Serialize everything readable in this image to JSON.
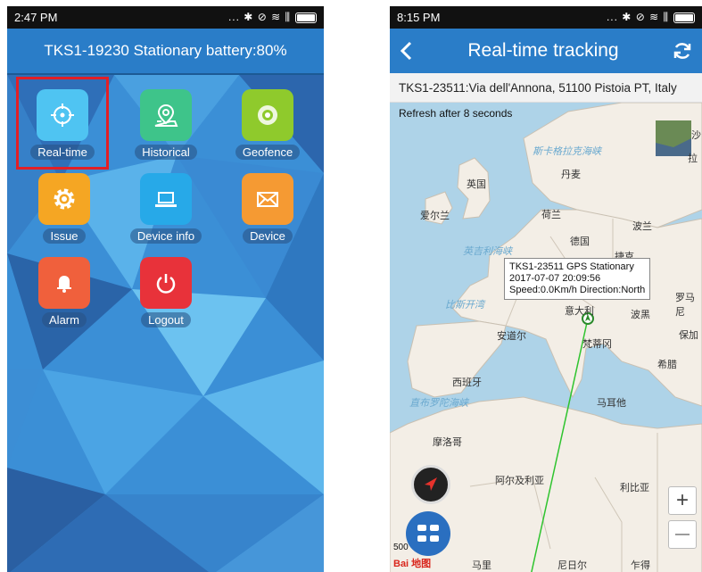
{
  "left_phone": {
    "status_time": "2:47 PM",
    "status_icons": "... ✱ ⊘ ≋ ⫼",
    "header_title": "TKS1-19230 Stationary battery:80%",
    "tiles": [
      {
        "label": "Real-time",
        "color": "#4fc4f2",
        "icon": "crosshair-icon"
      },
      {
        "label": "Historical",
        "color": "#3ec48a",
        "icon": "map-pin-icon"
      },
      {
        "label": "Geofence",
        "color": "#8fca2c",
        "icon": "target-icon"
      },
      {
        "label": "Issue",
        "color": "#f5a623",
        "icon": "gear-icon"
      },
      {
        "label": "Device info",
        "color": "#27a9e8",
        "icon": "laptop-icon"
      },
      {
        "label": "Device",
        "color": "#f59a33",
        "icon": "envelope-icon"
      },
      {
        "label": "Alarm",
        "color": "#f0603c",
        "icon": "bell-icon"
      },
      {
        "label": "Logout",
        "color": "#e8323a",
        "icon": "power-icon"
      }
    ]
  },
  "right_phone": {
    "status_time": "8:15 PM",
    "status_icons": "... ✱ ⊘ ≋ ⫼",
    "header_title": "Real-time tracking",
    "address": "TKS1-23511:Via dell'Annona, 51100 Pistoia PT, Italy",
    "refresh_text": "Refresh after 8 seconds",
    "popup": {
      "line1": "TKS1-23511 GPS Stationary",
      "line2": "2017-07-07 20:09:56",
      "line3": "Speed:0.0Km/h  Direction:North"
    },
    "map_labels": {
      "uk": "英国",
      "ireland": "爱尔兰",
      "denmark": "丹麦",
      "netherlands": "荷兰",
      "germany": "德国",
      "poland": "波兰",
      "czech": "捷克",
      "italy": "意大利",
      "andorra": "安道尔",
      "vatican": "梵蒂冈",
      "spain": "西班牙",
      "malta": "马耳他",
      "morocco": "摩洛哥",
      "algeria": "阿尔及利亚",
      "libya": "利比亚",
      "mali": "马里",
      "niger": "尼日尔",
      "chad": "乍得",
      "greece": "希腊",
      "romania": "罗马尼",
      "bulgaria": "保加",
      "bosnia": "波黑",
      "russia": "沙",
      "latvia": "拉"
    },
    "seas": {
      "skagerrak": "斯卡格拉克海峡",
      "english_channel": "英吉利海峡",
      "biscay": "比斯开湾",
      "gibraltar": "直布罗陀海峡"
    },
    "scale_text": "500",
    "baidu_logo": "Bai 地图",
    "zoom_in": "+",
    "zoom_out": "—"
  }
}
